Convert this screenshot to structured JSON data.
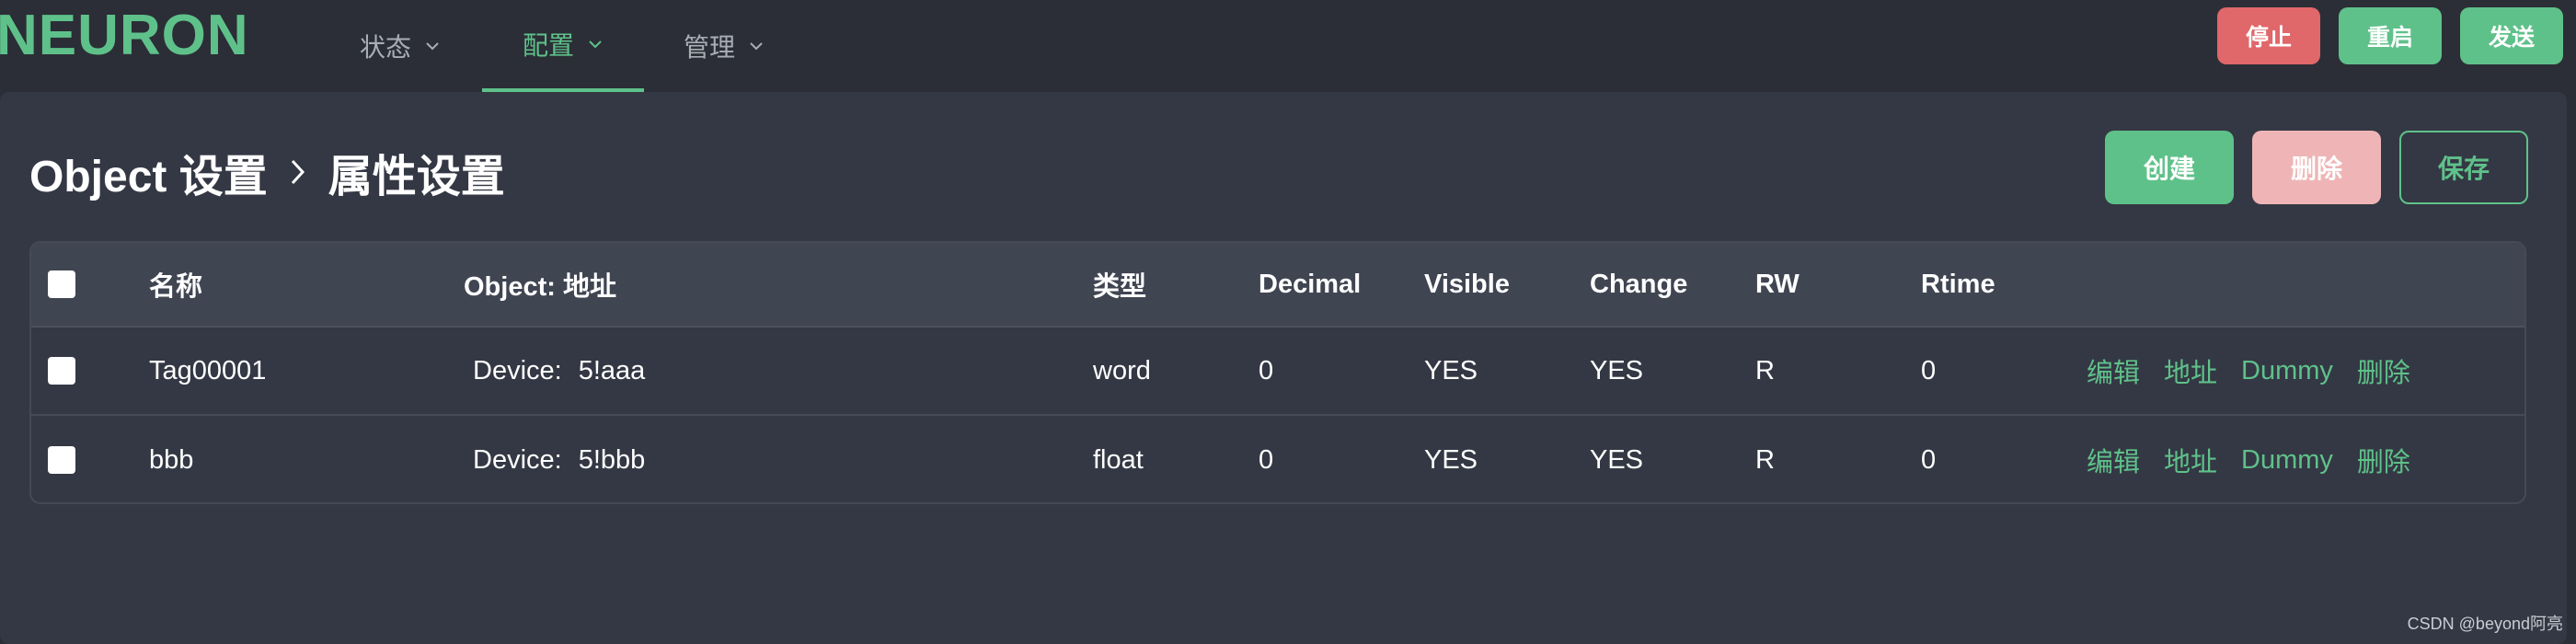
{
  "brand": {
    "logo": "NEURON"
  },
  "nav": [
    {
      "label": "状态",
      "active": false
    },
    {
      "label": "配置",
      "active": true
    },
    {
      "label": "管理",
      "active": false
    }
  ],
  "top_actions": {
    "stop": "停止",
    "restart": "重启",
    "send": "发送"
  },
  "breadcrumb": {
    "parent": "Object 设置",
    "current": "属性设置"
  },
  "actions": {
    "create": "创建",
    "delete": "删除",
    "save": "保存"
  },
  "table": {
    "columns": [
      "名称",
      "Object: 地址",
      "类型",
      "Decimal",
      "Visible",
      "Change",
      "RW",
      "Rtime"
    ],
    "rows": [
      {
        "name": "Tag00001",
        "device_label": "Device:",
        "address": "5!aaa",
        "type": "word",
        "decimal": "0",
        "visible": "YES",
        "change": "YES",
        "rw": "R",
        "rtime": "0",
        "links": {
          "edit": "编辑",
          "address": "地址",
          "dummy": "Dummy",
          "delete": "删除"
        }
      },
      {
        "name": "bbb",
        "device_label": "Device:",
        "address": "5!bbb",
        "type": "float",
        "decimal": "0",
        "visible": "YES",
        "change": "YES",
        "rw": "R",
        "rtime": "0",
        "links": {
          "edit": "编辑",
          "address": "地址",
          "dummy": "Dummy",
          "delete": "删除"
        }
      }
    ]
  },
  "watermark": "CSDN @beyond阿亮",
  "colors": {
    "accent": "#5fc18a",
    "danger": "#e0676a",
    "danger_disabled": "#efb5b6",
    "background": "#2b2e36",
    "panel": "#343844",
    "table_header": "#404552"
  },
  "icons": {
    "nav_chevron": "chevron-down-icon",
    "breadcrumb_separator": "chevron-right-icon"
  }
}
